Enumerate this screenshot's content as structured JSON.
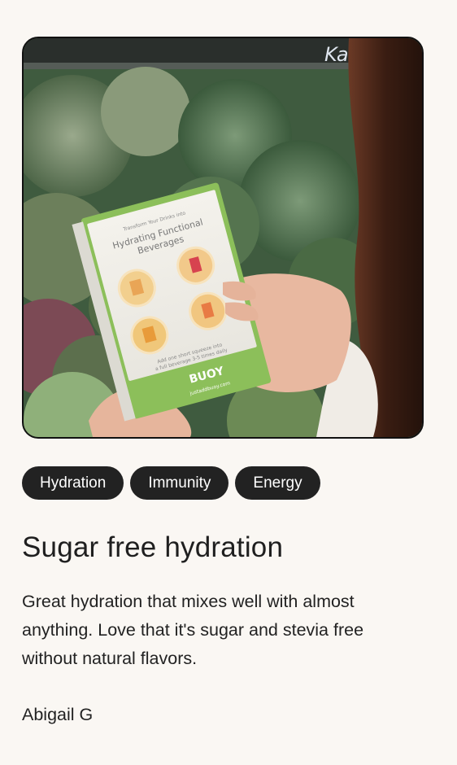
{
  "review": {
    "image_alt": "Hand holding a box of Hydrating Functional Beverages in a grocery produce aisle",
    "product_box": {
      "eyebrow": "Transform Your Drinks into",
      "headline_line1": "Hydrating Functional",
      "headline_line2": "Beverages",
      "brand": "BUOY",
      "url": "justaddbuoy.com",
      "instructions_line1": "Add one short squeeze into",
      "instructions_line2": "a full beverage 3-5 times daily"
    },
    "tags": [
      "Hydration",
      "Immunity",
      "Energy"
    ],
    "title": "Sugar free hydration",
    "body": "Great hydration that mixes well with almost anything. Love that it's sugar and stevia free without natural flavors.",
    "author": "Abigail G"
  },
  "colors": {
    "page_background": "#faf7f3",
    "tag_background": "#222222",
    "tag_text": "#ffffff",
    "text": "#1f1f1f",
    "box_green": "#8cbf5a"
  }
}
